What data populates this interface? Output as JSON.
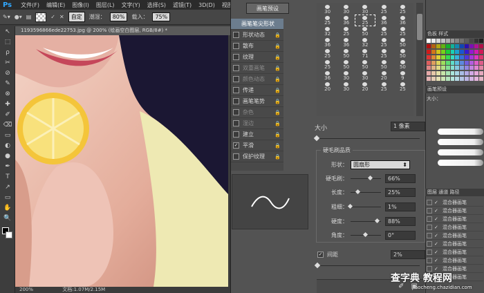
{
  "app": {
    "logo": "Ps",
    "menu": [
      "文件(F)",
      "编辑(E)",
      "图像(I)",
      "图层(L)",
      "文字(Y)",
      "选择(S)",
      "滤镜(T)",
      "3D(D)",
      "视图(V)",
      "窗口"
    ]
  },
  "options": {
    "mode": "自定",
    "wet_label": "潮湿：",
    "wet": "80%",
    "load_label": "载入：",
    "load": "75%"
  },
  "document": {
    "tab": "1193596866ede22753.jpg @ 200% (绘画空白图层, RGB/8#) *",
    "zoom": "200%",
    "doc_info": "文档:1.07M/2.15M"
  },
  "tools": [
    "↖",
    "⬚",
    "ρ",
    "✂",
    "⊘",
    "✎",
    "⊗",
    "✚",
    "✐",
    "⌫",
    "▭",
    "◐",
    "●",
    "✒",
    "T",
    "↗",
    "▭",
    "✋",
    "🔍"
  ],
  "brush_panel": {
    "preset_button": "画笔预设",
    "categories": [
      {
        "label": "画笔笔尖形状",
        "selected": true
      },
      {
        "label": "形状动态",
        "checked": false,
        "lock": true
      },
      {
        "label": "散布",
        "checked": false,
        "lock": true
      },
      {
        "label": "纹理",
        "checked": false,
        "lock": true
      },
      {
        "label": "双重画笔",
        "checked": false,
        "lock": true,
        "disabled": true
      },
      {
        "label": "颜色动态",
        "checked": false,
        "lock": true,
        "disabled": true
      },
      {
        "label": "传递",
        "checked": false,
        "lock": true
      },
      {
        "label": "画笔笔势",
        "checked": false,
        "lock": true
      },
      {
        "label": "杂色",
        "checked": false,
        "lock": true,
        "disabled": true
      },
      {
        "label": "湿边",
        "checked": false,
        "lock": true,
        "disabled": true
      },
      {
        "label": "建立",
        "checked": false,
        "lock": true
      },
      {
        "label": "平滑",
        "checked": true,
        "lock": true
      },
      {
        "label": "保护纹理",
        "checked": false,
        "lock": true
      }
    ],
    "brush_grid": [
      "30",
      "30",
      "30",
      "25",
      "25",
      "25",
      "36",
      "25",
      "36",
      "36",
      "32",
      "25",
      "50",
      "25",
      "25",
      "36",
      "36",
      "32",
      "25",
      "50",
      "25",
      "50",
      "71",
      "25",
      "50",
      "25",
      "50",
      "50",
      "50",
      "50",
      "36",
      "30",
      "30",
      "20",
      "9",
      "20",
      "30",
      "20",
      "25",
      "25"
    ],
    "size_label": "大小",
    "size_value": "1 像素",
    "bristle_title": "硬毛刷品质",
    "shape_label": "形状：",
    "shape_value": "圆扇形",
    "params": [
      {
        "label": "硬毛刷：",
        "value": "66%",
        "level": 0.66
      },
      {
        "label": "长度：",
        "value": "25%",
        "level": 0.25
      },
      {
        "label": "粗细：",
        "value": "1%",
        "level": 0.01
      },
      {
        "label": "硬度：",
        "value": "88%",
        "level": 0.88
      },
      {
        "label": "角度：",
        "value": "0°",
        "level": 0.5
      }
    ],
    "spacing_label": "间距",
    "spacing_value": "2%"
  },
  "right": {
    "swatch_tabs": "色板  样式",
    "brush_tabs": "画笔预设",
    "size_label": "大小：",
    "layers_tabs": "图层  通道  路径",
    "layers": [
      "混合器画笔",
      "混合器画笔",
      "混合器画笔",
      "混合器画笔",
      "混合器画笔",
      "混合器画笔",
      "混合器画笔",
      "混合器画笔",
      "混合器画笔",
      "混合器画笔"
    ]
  },
  "watermark": {
    "main": "查字典 教程网",
    "sub": "jiaocheng.chazidian.com"
  }
}
